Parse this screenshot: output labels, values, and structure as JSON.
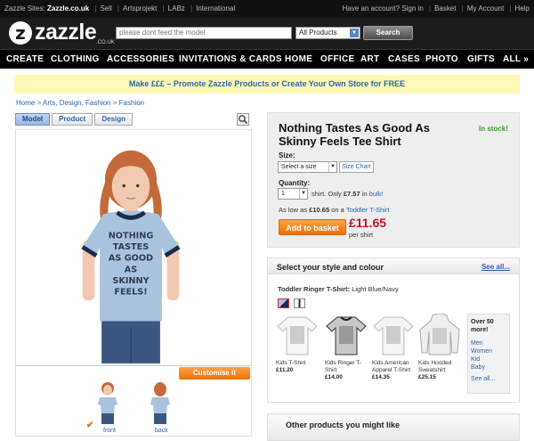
{
  "topbar": {
    "sites_label": "Zazzle Sites:",
    "current_site": "Zazzle.co.uk",
    "links": [
      "Sell",
      "Artsprojekt",
      "LABz",
      "International"
    ],
    "account_prompt": "Have an account? Sign in",
    "basket": "Basket",
    "my_account": "My Account",
    "help": "Help"
  },
  "header": {
    "logo_text": "zazzle",
    "logo_mark": "z",
    "logo_tld": ".CO.UK",
    "search_placeholder": "please dont feed the model",
    "category_selected": "All Products",
    "search_button": "Search"
  },
  "nav": {
    "items": [
      "CREATE",
      "CLOTHING",
      "ACCESSORIES",
      "INVITATIONS & CARDS",
      "HOME",
      "OFFICE",
      "ART",
      "CASES",
      "PHOTO",
      "GIFTS",
      "ALL »"
    ]
  },
  "promo": {
    "text": "Make £££ – Promote Zazzle Products or Create Your Own Store for FREE"
  },
  "breadcrumb": {
    "items": [
      "Home",
      "Arts, Design, Fashion",
      "Fashion"
    ],
    "separator": ">"
  },
  "viewer": {
    "tabs": [
      "Model",
      "Product",
      "Design"
    ],
    "active_tab": "Model",
    "shirt_text": [
      "NOTHING",
      "TASTES",
      "AS GOOD",
      "AS",
      "SKINNY",
      "FEELS!"
    ],
    "customise_button": "Customise it",
    "thumb_labels": [
      "front",
      "back"
    ]
  },
  "product": {
    "title": "Nothing Tastes As Good As Skinny Feels Tee Shirt",
    "stock": "In stock!",
    "size_label": "Size:",
    "size_select": "Select a size",
    "size_chart": "Size Chart",
    "quantity_label": "Quantity:",
    "quantity_value": "1",
    "quantity_unit": "shirt.",
    "bulk_only": "Only",
    "bulk_price": "£7.57",
    "bulk_in": "in",
    "bulk_link": "bulk!",
    "as_low_as": "As low as",
    "low_price": "£10.65",
    "on_a": "on a",
    "low_link": "Toddler T-Shirt",
    "add_button": "Add to basket",
    "price": "£11.65",
    "per_unit": "per shirt"
  },
  "style": {
    "heading": "Select your style and colour",
    "see_all": "See all...",
    "current_label": "Toddler Ringer T-Shirt:",
    "current_colour": "Light Blue/Navy",
    "variants": [
      {
        "name": "Kids T-Shirt",
        "price": "£11.20"
      },
      {
        "name": "Kids Ringer T-Shirt",
        "price": "£14.00"
      },
      {
        "name": "Kids American Apparel T-Shirt",
        "price": "£14.35"
      },
      {
        "name": "Kids Hooded Sweatshirt",
        "price": "£25.15"
      }
    ],
    "more_heading": "Over 50 more!",
    "more_links": [
      "Men",
      "Women",
      "Kid",
      "Baby"
    ],
    "more_see_all": "See all..."
  },
  "other": {
    "heading": "Other products you might like"
  },
  "colors": {
    "accent_orange": "#ee6f00",
    "price_red": "#c8102e",
    "link_blue": "#2a66b0",
    "stock_green": "#3a9c2a",
    "promo_yellow": "#fff9b5"
  }
}
